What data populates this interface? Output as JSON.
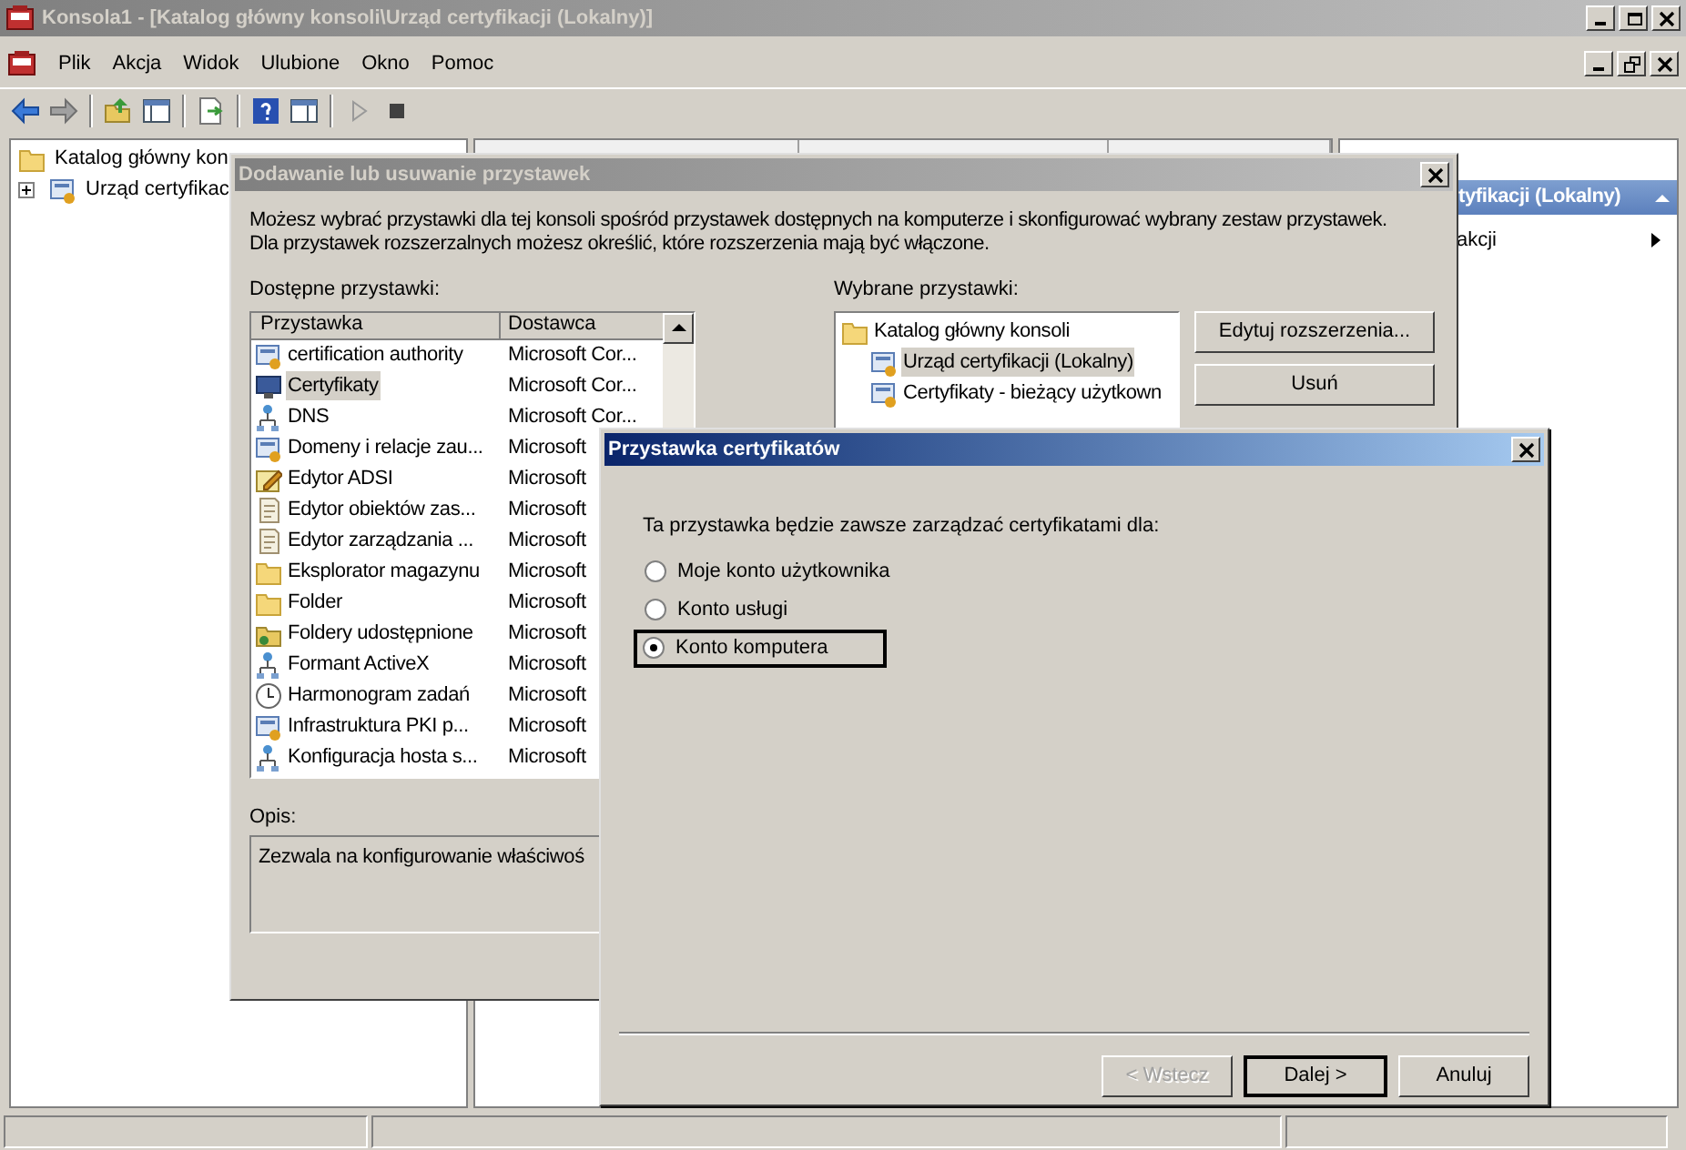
{
  "main_window": {
    "title": "Konsola1 - [Katalog główny konsoli\\Urząd certyfikacji (Lokalny)]",
    "menu": [
      "Plik",
      "Akcja",
      "Widok",
      "Ulubione",
      "Okno",
      "Pomoc"
    ],
    "tree": [
      {
        "label": "Katalog główny kon",
        "children": [
          {
            "label": "Urząd certyfikac",
            "expanded": false
          }
        ]
      }
    ],
    "actions_pane": {
      "header": "tyfikacji (Lokalny)",
      "items": [
        "akcji"
      ]
    }
  },
  "snapin_dialog": {
    "title": "Dodawanie lub usuwanie przystawek",
    "intro_lines": [
      "Możesz wybrać przystawki dla tej konsoli spośród przystawek dostępnych na komputerze i skonfigurować wybrany zestaw przystawek.",
      "Dla przystawek rozszerzalnych możesz określić, które rozszerzenia mają być włączone."
    ],
    "available_label": "Dostępne przystawki:",
    "columns": [
      "Przystawka",
      "Dostawca"
    ],
    "available": [
      {
        "name": "certification authority",
        "vendor": "Microsoft Cor...",
        "selected": false
      },
      {
        "name": "Certyfikaty",
        "vendor": "Microsoft Cor...",
        "selected": true
      },
      {
        "name": "DNS",
        "vendor": "Microsoft Cor...",
        "selected": false
      },
      {
        "name": "Domeny i relacje zau...",
        "vendor": "Microsoft",
        "selected": false
      },
      {
        "name": "Edytor ADSI",
        "vendor": "Microsoft",
        "selected": false
      },
      {
        "name": "Edytor obiektów zas...",
        "vendor": "Microsoft",
        "selected": false
      },
      {
        "name": "Edytor zarządzania ...",
        "vendor": "Microsoft",
        "selected": false
      },
      {
        "name": "Eksplorator magazynu",
        "vendor": "Microsoft",
        "selected": false
      },
      {
        "name": "Folder",
        "vendor": "Microsoft",
        "selected": false
      },
      {
        "name": "Foldery udostępnione",
        "vendor": "Microsoft",
        "selected": false
      },
      {
        "name": "Formant ActiveX",
        "vendor": "Microsoft",
        "selected": false
      },
      {
        "name": "Harmonogram zadań",
        "vendor": "Microsoft",
        "selected": false
      },
      {
        "name": "Infrastruktura PKI p...",
        "vendor": "Microsoft",
        "selected": false
      },
      {
        "name": "Konfiguracja hosta s...",
        "vendor": "Microsoft",
        "selected": false
      }
    ],
    "selected_label": "Wybrane przystawki:",
    "selected_tree": [
      {
        "label": "Katalog główny konsoli",
        "selected": false,
        "children": [
          {
            "label": "Urząd certyfikacji (Lokalny)",
            "selected": true
          },
          {
            "label": "Certyfikaty - bieżący użytkown",
            "selected": false
          }
        ]
      }
    ],
    "side_buttons": [
      "Edytuj rozszerzenia...",
      "Usuń"
    ],
    "description_label": "Opis:",
    "description": "Zezwala na konfigurowanie właściwoś"
  },
  "cert_dialog": {
    "title": "Przystawka certyfikatów",
    "prompt": "Ta przystawka będzie zawsze zarządzać certyfikatami dla:",
    "options": [
      {
        "label": "Moje konto użytkownika",
        "selected": false,
        "focused": false
      },
      {
        "label": "Konto usługi",
        "selected": false,
        "focused": false
      },
      {
        "label": "Konto komputera",
        "selected": true,
        "focused": true
      }
    ],
    "buttons": [
      {
        "label": "< Wstecz",
        "disabled": true,
        "default": false
      },
      {
        "label": "Dalej >",
        "disabled": false,
        "default": true
      },
      {
        "label": "Anuluj",
        "disabled": false,
        "default": false
      }
    ]
  }
}
